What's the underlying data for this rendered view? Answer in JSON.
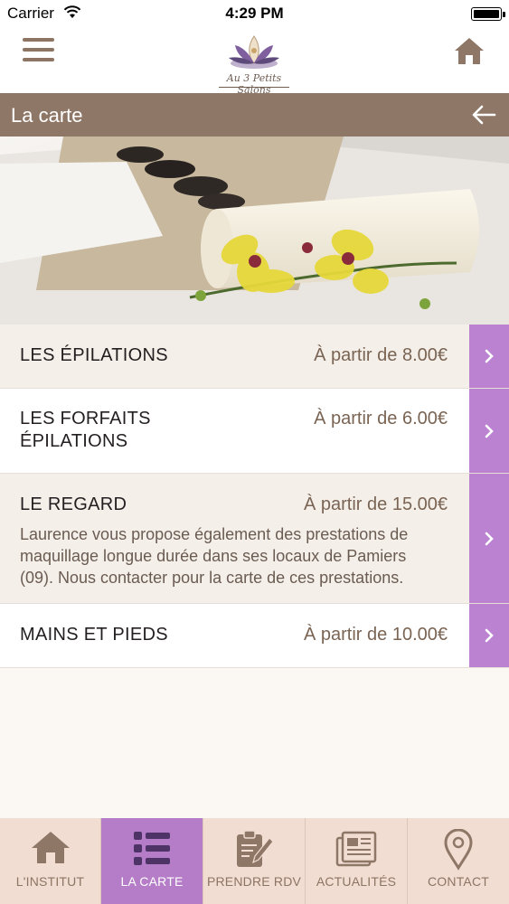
{
  "status_bar": {
    "carrier": "Carrier",
    "time": "4:29 PM"
  },
  "header": {
    "logo_text": "Au 3 Petits Salons",
    "menu_icon": "hamburger-icon",
    "home_icon": "home-icon"
  },
  "titlebar": {
    "title": "La carte",
    "back_icon": "arrow-left-icon"
  },
  "menu_items": [
    {
      "title": "LES ÉPILATIONS",
      "price": "À partir de 8.00€"
    },
    {
      "title_line1": "LES FORFAITS",
      "title_line2": "ÉPILATIONS",
      "price": "À partir de 6.00€"
    },
    {
      "title": "LE REGARD",
      "price": "À partir de 15.00€",
      "description_lines": [
        "Laurence vous propose également des prestations de",
        "maquillage longue durée dans ses locaux de Pamiers",
        "(09). Nous contacter pour la carte de ces prestations."
      ]
    },
    {
      "title": "MAINS ET PIEDS",
      "price": "À partir de 10.00€"
    }
  ],
  "tabs": [
    {
      "label": "L'INSTITUT",
      "icon": "home-icon",
      "active": false
    },
    {
      "label": "LA CARTE",
      "icon": "list-icon",
      "active": true
    },
    {
      "label": "PRENDRE RDV",
      "icon": "clipboard-pen-icon",
      "active": false
    },
    {
      "label": "ACTUALITÉS",
      "icon": "newspaper-icon",
      "active": false
    },
    {
      "label": "CONTACT",
      "icon": "map-pin-icon",
      "active": false
    }
  ],
  "colors": {
    "brand_brown": "#8f7767",
    "accent_purple": "#bb82d2",
    "active_tab": "#b57dc7",
    "tabbar_bg": "#f1ddd2"
  }
}
